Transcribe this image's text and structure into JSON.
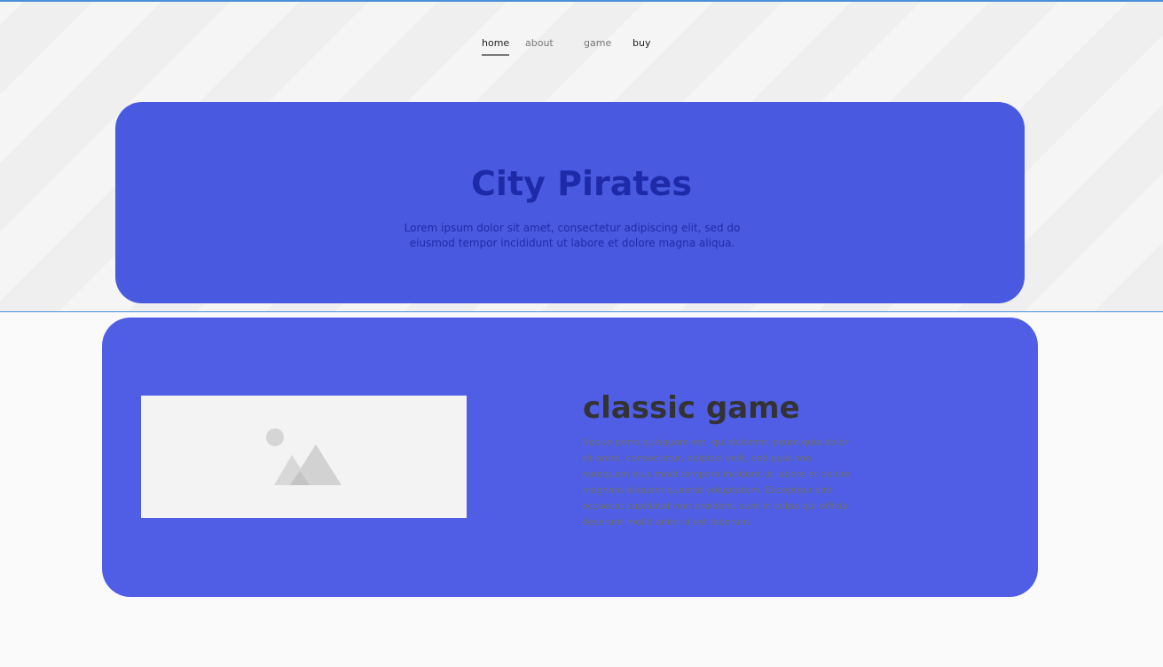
{
  "nav": {
    "items": [
      {
        "label": "home"
      },
      {
        "label": "about"
      },
      {
        "label": "game"
      },
      {
        "label": "buy"
      }
    ]
  },
  "hero": {
    "title": "City Pirates",
    "text": "Lorem ipsum dolor sit amet, consectetur adipiscing elit, sed do eiusmod tempor incididunt ut labore et dolore magna aliqua."
  },
  "game": {
    "title": "classic game",
    "text": "Neque porro quisquam est, qui dolorem ipsum quia dolor sit amet, consectetur, adipisci velit, sed quia non numquam eius modi tempora incidunt ut labore et dolore magnam aliquam quaerat voluptatem. Excepteur sint occaecat cupidatat non proident, sunt in culpa qui officia deserunt mollit anim id est laborum."
  },
  "colors": {
    "hero_bg": "#4a5ae0",
    "card_bg": "#4f5ee5",
    "title_blue": "#1e2aa8",
    "frame_line": "#4a90d9"
  },
  "icons": {
    "image_placeholder": "image-icon"
  }
}
